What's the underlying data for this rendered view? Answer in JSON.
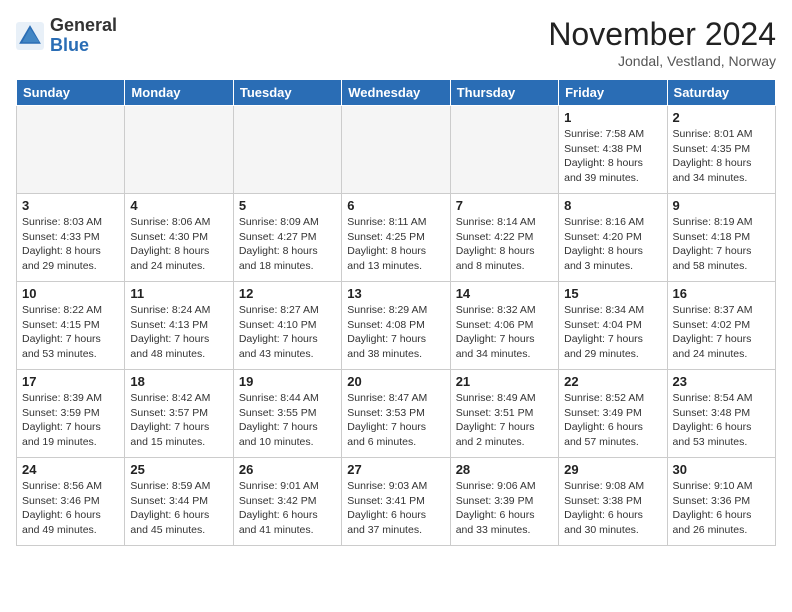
{
  "header": {
    "logo_general": "General",
    "logo_blue": "Blue",
    "title": "November 2024",
    "location": "Jondal, Vestland, Norway"
  },
  "days_of_week": [
    "Sunday",
    "Monday",
    "Tuesday",
    "Wednesday",
    "Thursday",
    "Friday",
    "Saturday"
  ],
  "weeks": [
    [
      {
        "day": "",
        "text": ""
      },
      {
        "day": "",
        "text": ""
      },
      {
        "day": "",
        "text": ""
      },
      {
        "day": "",
        "text": ""
      },
      {
        "day": "",
        "text": ""
      },
      {
        "day": "1",
        "text": "Sunrise: 7:58 AM\nSunset: 4:38 PM\nDaylight: 8 hours\nand 39 minutes."
      },
      {
        "day": "2",
        "text": "Sunrise: 8:01 AM\nSunset: 4:35 PM\nDaylight: 8 hours\nand 34 minutes."
      }
    ],
    [
      {
        "day": "3",
        "text": "Sunrise: 8:03 AM\nSunset: 4:33 PM\nDaylight: 8 hours\nand 29 minutes."
      },
      {
        "day": "4",
        "text": "Sunrise: 8:06 AM\nSunset: 4:30 PM\nDaylight: 8 hours\nand 24 minutes."
      },
      {
        "day": "5",
        "text": "Sunrise: 8:09 AM\nSunset: 4:27 PM\nDaylight: 8 hours\nand 18 minutes."
      },
      {
        "day": "6",
        "text": "Sunrise: 8:11 AM\nSunset: 4:25 PM\nDaylight: 8 hours\nand 13 minutes."
      },
      {
        "day": "7",
        "text": "Sunrise: 8:14 AM\nSunset: 4:22 PM\nDaylight: 8 hours\nand 8 minutes."
      },
      {
        "day": "8",
        "text": "Sunrise: 8:16 AM\nSunset: 4:20 PM\nDaylight: 8 hours\nand 3 minutes."
      },
      {
        "day": "9",
        "text": "Sunrise: 8:19 AM\nSunset: 4:18 PM\nDaylight: 7 hours\nand 58 minutes."
      }
    ],
    [
      {
        "day": "10",
        "text": "Sunrise: 8:22 AM\nSunset: 4:15 PM\nDaylight: 7 hours\nand 53 minutes."
      },
      {
        "day": "11",
        "text": "Sunrise: 8:24 AM\nSunset: 4:13 PM\nDaylight: 7 hours\nand 48 minutes."
      },
      {
        "day": "12",
        "text": "Sunrise: 8:27 AM\nSunset: 4:10 PM\nDaylight: 7 hours\nand 43 minutes."
      },
      {
        "day": "13",
        "text": "Sunrise: 8:29 AM\nSunset: 4:08 PM\nDaylight: 7 hours\nand 38 minutes."
      },
      {
        "day": "14",
        "text": "Sunrise: 8:32 AM\nSunset: 4:06 PM\nDaylight: 7 hours\nand 34 minutes."
      },
      {
        "day": "15",
        "text": "Sunrise: 8:34 AM\nSunset: 4:04 PM\nDaylight: 7 hours\nand 29 minutes."
      },
      {
        "day": "16",
        "text": "Sunrise: 8:37 AM\nSunset: 4:02 PM\nDaylight: 7 hours\nand 24 minutes."
      }
    ],
    [
      {
        "day": "17",
        "text": "Sunrise: 8:39 AM\nSunset: 3:59 PM\nDaylight: 7 hours\nand 19 minutes."
      },
      {
        "day": "18",
        "text": "Sunrise: 8:42 AM\nSunset: 3:57 PM\nDaylight: 7 hours\nand 15 minutes."
      },
      {
        "day": "19",
        "text": "Sunrise: 8:44 AM\nSunset: 3:55 PM\nDaylight: 7 hours\nand 10 minutes."
      },
      {
        "day": "20",
        "text": "Sunrise: 8:47 AM\nSunset: 3:53 PM\nDaylight: 7 hours\nand 6 minutes."
      },
      {
        "day": "21",
        "text": "Sunrise: 8:49 AM\nSunset: 3:51 PM\nDaylight: 7 hours\nand 2 minutes."
      },
      {
        "day": "22",
        "text": "Sunrise: 8:52 AM\nSunset: 3:49 PM\nDaylight: 6 hours\nand 57 minutes."
      },
      {
        "day": "23",
        "text": "Sunrise: 8:54 AM\nSunset: 3:48 PM\nDaylight: 6 hours\nand 53 minutes."
      }
    ],
    [
      {
        "day": "24",
        "text": "Sunrise: 8:56 AM\nSunset: 3:46 PM\nDaylight: 6 hours\nand 49 minutes."
      },
      {
        "day": "25",
        "text": "Sunrise: 8:59 AM\nSunset: 3:44 PM\nDaylight: 6 hours\nand 45 minutes."
      },
      {
        "day": "26",
        "text": "Sunrise: 9:01 AM\nSunset: 3:42 PM\nDaylight: 6 hours\nand 41 minutes."
      },
      {
        "day": "27",
        "text": "Sunrise: 9:03 AM\nSunset: 3:41 PM\nDaylight: 6 hours\nand 37 minutes."
      },
      {
        "day": "28",
        "text": "Sunrise: 9:06 AM\nSunset: 3:39 PM\nDaylight: 6 hours\nand 33 minutes."
      },
      {
        "day": "29",
        "text": "Sunrise: 9:08 AM\nSunset: 3:38 PM\nDaylight: 6 hours\nand 30 minutes."
      },
      {
        "day": "30",
        "text": "Sunrise: 9:10 AM\nSunset: 3:36 PM\nDaylight: 6 hours\nand 26 minutes."
      }
    ]
  ]
}
